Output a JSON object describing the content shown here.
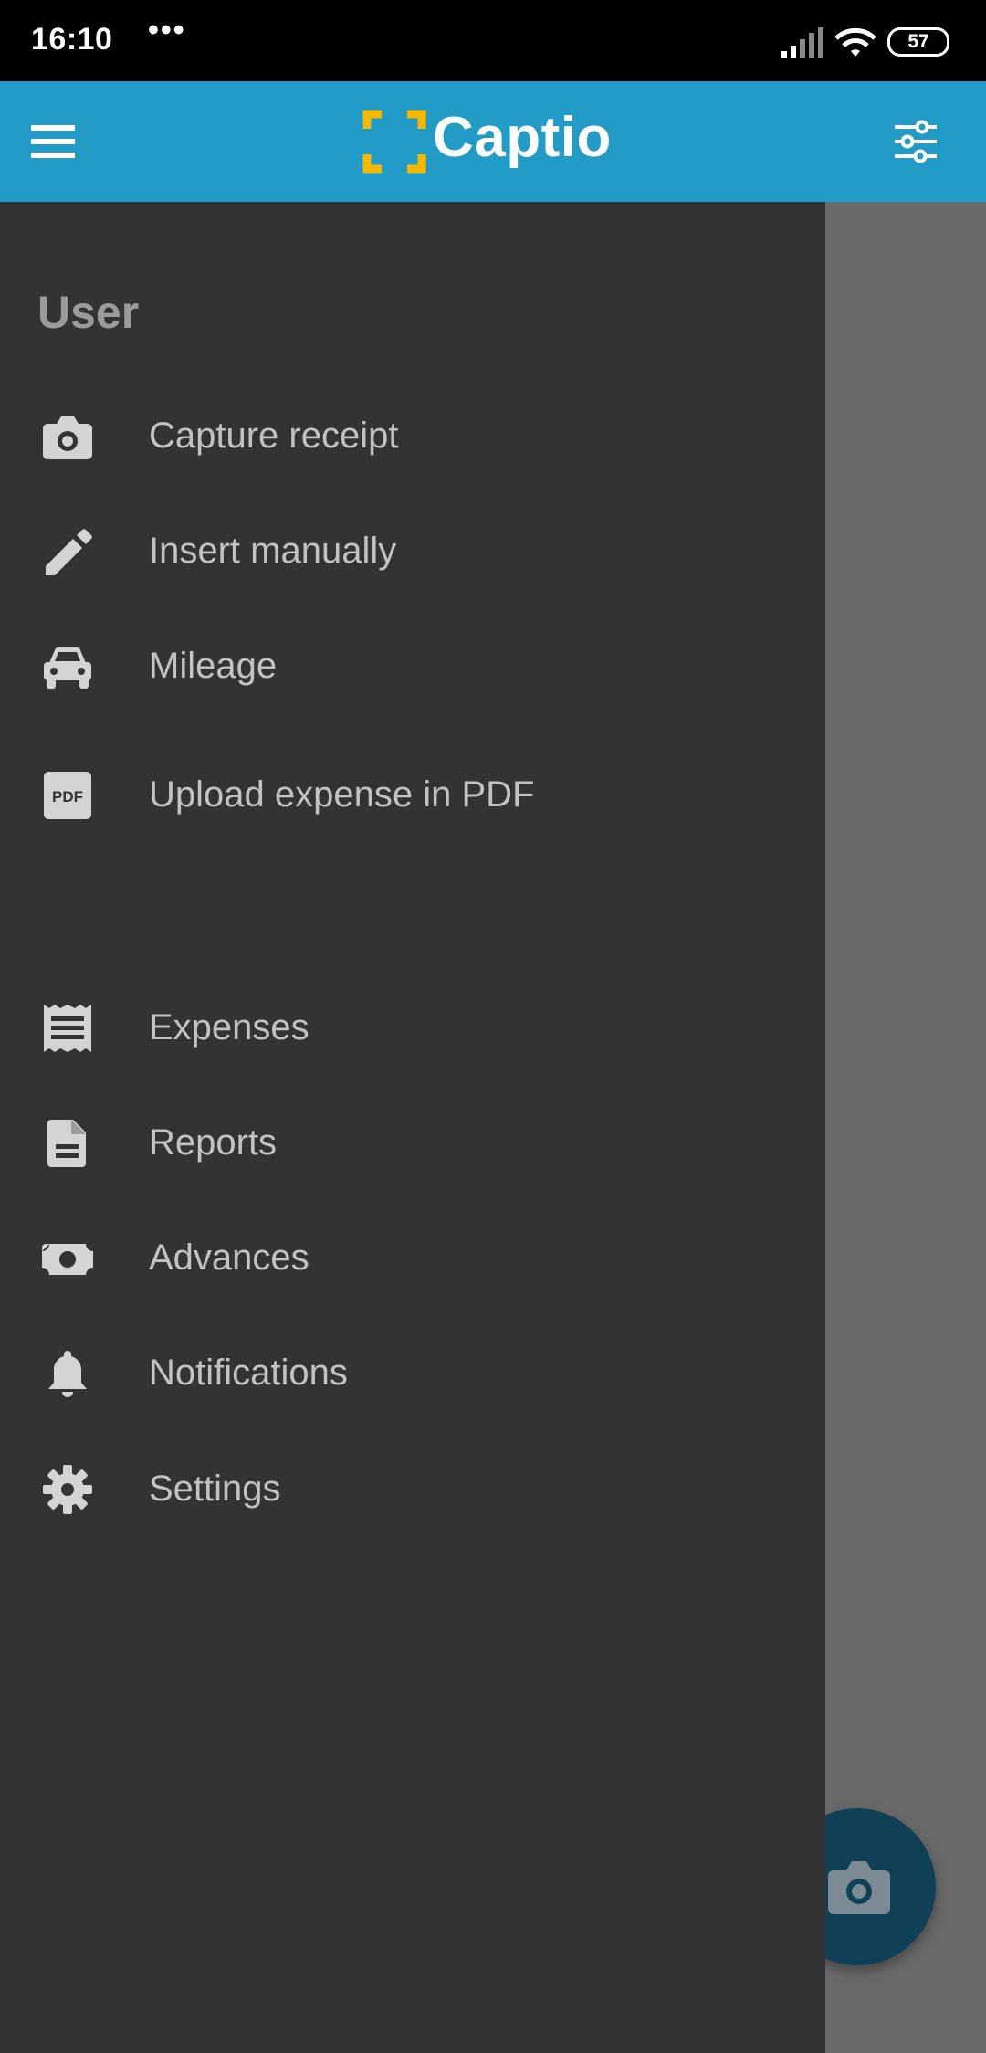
{
  "status_bar": {
    "time": "16:10",
    "dots": "•••",
    "battery": "57"
  },
  "app_bar": {
    "brand": "Captio",
    "colors": {
      "background": "#239bc7",
      "logo_accent": "#f5b800"
    },
    "icons": {
      "menu": "menu-icon",
      "filter": "filter-sliders-icon"
    }
  },
  "drawer": {
    "section_title": "User",
    "primary_items": [
      {
        "icon": "camera-icon",
        "label": "Capture receipt"
      },
      {
        "icon": "pencil-icon",
        "label": "Insert manually"
      },
      {
        "icon": "car-icon",
        "label": "Mileage"
      },
      {
        "icon": "pdf-icon",
        "label": "Upload expense in PDF"
      }
    ],
    "secondary_items": [
      {
        "icon": "receipt-icon",
        "label": "Expenses"
      },
      {
        "icon": "document-icon",
        "label": "Reports"
      },
      {
        "icon": "money-icon",
        "label": "Advances"
      },
      {
        "icon": "bell-icon",
        "label": "Notifications"
      },
      {
        "icon": "gear-icon",
        "label": "Settings"
      }
    ]
  },
  "fab": {
    "icon": "camera-icon",
    "color": "#0f4056"
  }
}
